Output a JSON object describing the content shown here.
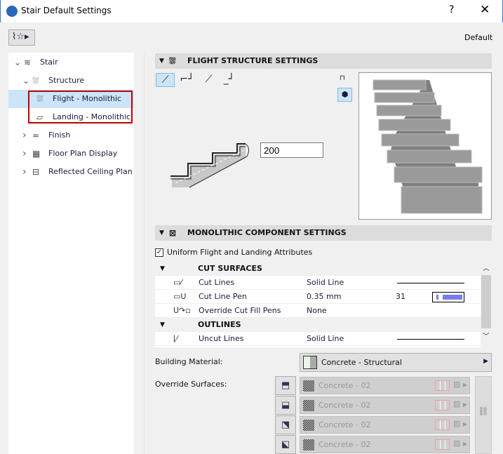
{
  "window": {
    "title": "Stair Default Settings",
    "help": "?",
    "close": "✕"
  },
  "toolbar": {
    "favorites_icon": "stair-star-icon",
    "default_label": "Default"
  },
  "tree": [
    {
      "label": "Stair",
      "icon": "stair-icon",
      "expanded": true,
      "level": 0
    },
    {
      "label": "Structure",
      "icon": "structure-icon",
      "expanded": true,
      "level": 1
    },
    {
      "label": "Flight - Monolithic",
      "icon": "flight-icon",
      "level": 2,
      "selected": true
    },
    {
      "label": "Landing - Monolithic",
      "icon": "landing-icon",
      "level": 2
    },
    {
      "label": "Finish",
      "icon": "finish-icon",
      "expanded": false,
      "level": 1
    },
    {
      "label": "Floor Plan Display",
      "icon": "floor-plan-icon",
      "expanded": false,
      "level": 1
    },
    {
      "label": "Reflected Ceiling Plan Di",
      "icon": "ceiling-plan-icon",
      "expanded": false,
      "level": 1
    }
  ],
  "flight_section": {
    "title": "FLIGHT STRUCTURE SETTINGS",
    "thickness_value": "200",
    "selected_type": 0
  },
  "monolithic_section": {
    "title": "MONOLITHIC COMPONENT SETTINGS",
    "uniform_label": "Uniform Flight and Landing Attributes",
    "uniform_checked": true
  },
  "table": [
    {
      "group": "CUT SURFACES"
    },
    {
      "name": "Cut Lines",
      "value": "Solid Line",
      "icon": "cut-lines-icon"
    },
    {
      "name": "Cut Line Pen",
      "value": "0.35 mm",
      "number": "31",
      "icon": "cut-line-pen-icon",
      "pen_color": "#7b7bf0"
    },
    {
      "name": "Override Cut Fill Pens",
      "value": "None",
      "icon": "override-pens-icon"
    },
    {
      "group": "OUTLINES"
    },
    {
      "name": "Uncut Lines",
      "value": "Solid Line",
      "icon": "uncut-lines-icon"
    }
  ],
  "building_material": {
    "label": "Building Material:",
    "value": "Concrete - Structural"
  },
  "override_surfaces": {
    "label": "Override Surfaces:",
    "items": [
      "Concrete - 02",
      "Concrete - 02",
      "Concrete - 02",
      "Concrete - 02"
    ]
  }
}
